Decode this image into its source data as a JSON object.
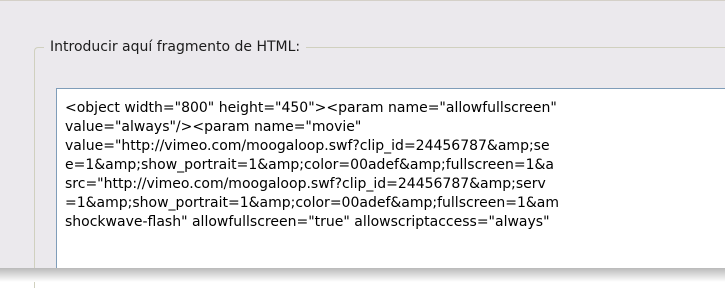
{
  "groupbox": {
    "label": "Introducir aquí fragmento de HTML:"
  },
  "textarea": {
    "lines": [
      "<object width=\"800\" height=\"450\"><param name=\"allowfullscreen\"",
      "value=\"always\"/><param name=\"movie\"",
      "value=\"http://vimeo.com/moogaloop.swf?clip_id=24456787&amp;se",
      "e=1&amp;show_portrait=1&amp;color=00adef&amp;fullscreen=1&a",
      "src=\"http://vimeo.com/moogaloop.swf?clip_id=24456787&amp;serv",
      "=1&amp;show_portrait=1&amp;color=00adef&amp;fullscreen=1&am",
      "shockwave-flash\" allowfullscreen=\"true\" allowscriptaccess=\"always\""
    ]
  }
}
